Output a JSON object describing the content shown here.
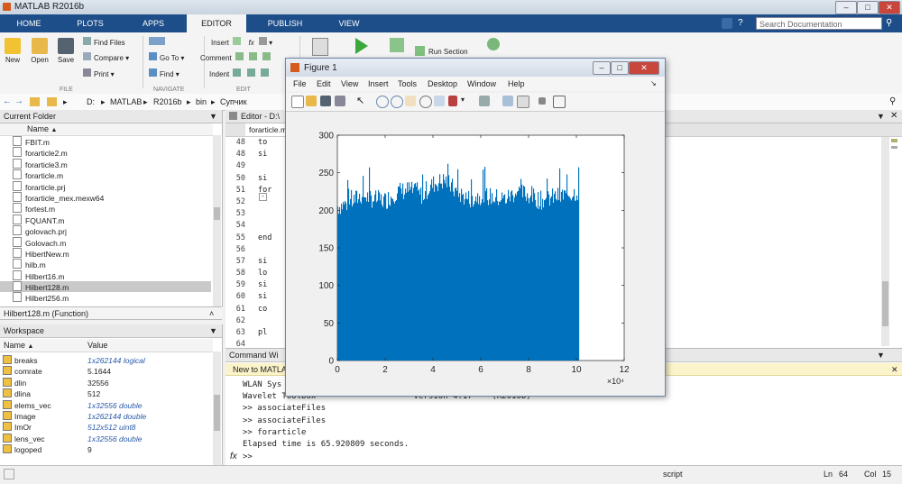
{
  "window": {
    "title": "MATLAB R2016b"
  },
  "ribbon": {
    "tabs": [
      {
        "label": "HOME"
      },
      {
        "label": "PLOTS"
      },
      {
        "label": "APPS"
      },
      {
        "label": "EDITOR"
      },
      {
        "label": "PUBLISH"
      },
      {
        "label": "VIEW"
      }
    ],
    "search_placeholder": "Search Documentation",
    "file": {
      "new": "New",
      "open": "Open",
      "save": "Save",
      "find_files": "Find Files",
      "compare": "Compare",
      "print": "Print",
      "section": "FILE"
    },
    "navigate": {
      "go_to": "Go To",
      "find": "Find",
      "section": "NAVIGATE"
    },
    "edit": {
      "insert": "Insert",
      "comment": "Comment",
      "indent": "Indent",
      "section": "EDIT"
    },
    "run_section": "Run Section",
    "colors": {
      "tabbar": "#1d4e89",
      "accent": "#0072bd"
    }
  },
  "address": {
    "segments": [
      "D:",
      "MATLAB",
      "R2016b",
      "bin",
      "Супчик"
    ]
  },
  "current_folder": {
    "title": "Current Folder",
    "column": "Name",
    "files": [
      "FBIT.m",
      "forarticle2.m",
      "forarticle3.m",
      "forarticle.m",
      "forarticle.prj",
      "forarticle_mex.mexw64",
      "fortest.m",
      "FQUANT.m",
      "golovach.prj",
      "Golovach.m",
      "HibertNew.m",
      "hilb.m",
      "Hilbert16.m",
      "Hilbert128.m",
      "Hilbert256.m"
    ],
    "selected_index": 13,
    "details": "Hilbert128.m  (Function)"
  },
  "workspace": {
    "title": "Workspace",
    "columns": [
      "Name",
      "Value"
    ],
    "rows": [
      {
        "name": "breaks",
        "value": "1x262144 logical"
      },
      {
        "name": "comrate",
        "value": "5.1644"
      },
      {
        "name": "dlin",
        "value": "32556"
      },
      {
        "name": "dlina",
        "value": "512"
      },
      {
        "name": "elems_vec",
        "value": "1x32556 double"
      },
      {
        "name": "Image",
        "value": "1x262144 double"
      },
      {
        "name": "ImOr",
        "value": "512x512 uint8"
      },
      {
        "name": "lens_vec",
        "value": "1x32556 double"
      },
      {
        "name": "logoped",
        "value": "9"
      }
    ]
  },
  "editor": {
    "title": "Editor - D:\\",
    "tab": "forarticle.m",
    "lines": [
      {
        "n": "48",
        "code": "to"
      },
      {
        "n": "48",
        "code": "si"
      },
      {
        "n": "49",
        "code": ""
      },
      {
        "n": "50",
        "code": "si"
      },
      {
        "n": "51",
        "code": "for"
      },
      {
        "n": "52",
        "code": ""
      },
      {
        "n": "53",
        "code": ""
      },
      {
        "n": "54",
        "code": ""
      },
      {
        "n": "55",
        "code": "end"
      },
      {
        "n": "56",
        "code": ""
      },
      {
        "n": "57",
        "code": "si"
      },
      {
        "n": "58",
        "code": "lo"
      },
      {
        "n": "59",
        "code": "si"
      },
      {
        "n": "60",
        "code": "si"
      },
      {
        "n": "61",
        "code": "co"
      },
      {
        "n": "62",
        "code": ""
      },
      {
        "n": "63",
        "code": "pl"
      },
      {
        "n": "64",
        "code": ""
      }
    ]
  },
  "command_window": {
    "title": "Command Wi",
    "banner": "New to MATLAB",
    "lines": [
      "WLAN Sys                                          2016b)",
      "Wavelet Toolbox                    Version 4.17    (R2016b)",
      ">> associateFiles",
      ">> associateFiles",
      ">> forarticle",
      "Elapsed time is 65.920809 seconds."
    ],
    "prompt_symbol": "fx",
    "prompt": ">>"
  },
  "status": {
    "mode": "script",
    "ln_label": "Ln",
    "ln": "64",
    "col_label": "Col",
    "col": "15"
  },
  "figure": {
    "title": "Figure 1",
    "menu": [
      "File",
      "Edit",
      "View",
      "Insert",
      "Tools",
      "Desktop",
      "Window",
      "Help"
    ]
  },
  "chart_data": {
    "type": "bar",
    "title": "",
    "xlabel": "",
    "ylabel": "",
    "xlim": [
      0,
      120000
    ],
    "ylim": [
      0,
      300
    ],
    "x_ticks": [
      "0",
      "2",
      "4",
      "6",
      "8",
      "10",
      "12"
    ],
    "y_ticks": [
      "0",
      "50",
      "100",
      "150",
      "200",
      "250",
      "300"
    ],
    "x_exponent_label": "×10⁴",
    "x_range": [
      0,
      101000
    ],
    "approx_envelope": [
      {
        "x": 0,
        "y": 210
      },
      {
        "x": 5000,
        "y": 215
      },
      {
        "x": 10000,
        "y": 225
      },
      {
        "x": 15000,
        "y": 220
      },
      {
        "x": 20000,
        "y": 218
      },
      {
        "x": 25000,
        "y": 230
      },
      {
        "x": 30000,
        "y": 232
      },
      {
        "x": 35000,
        "y": 225
      },
      {
        "x": 40000,
        "y": 240
      },
      {
        "x": 45000,
        "y": 245
      },
      {
        "x": 50000,
        "y": 228
      },
      {
        "x": 55000,
        "y": 220
      },
      {
        "x": 60000,
        "y": 225
      },
      {
        "x": 65000,
        "y": 222
      },
      {
        "x": 70000,
        "y": 220
      },
      {
        "x": 75000,
        "y": 230
      },
      {
        "x": 80000,
        "y": 225
      },
      {
        "x": 85000,
        "y": 218
      },
      {
        "x": 90000,
        "y": 222
      },
      {
        "x": 95000,
        "y": 225
      },
      {
        "x": 101000,
        "y": 230
      }
    ],
    "color": "#0072bd"
  }
}
